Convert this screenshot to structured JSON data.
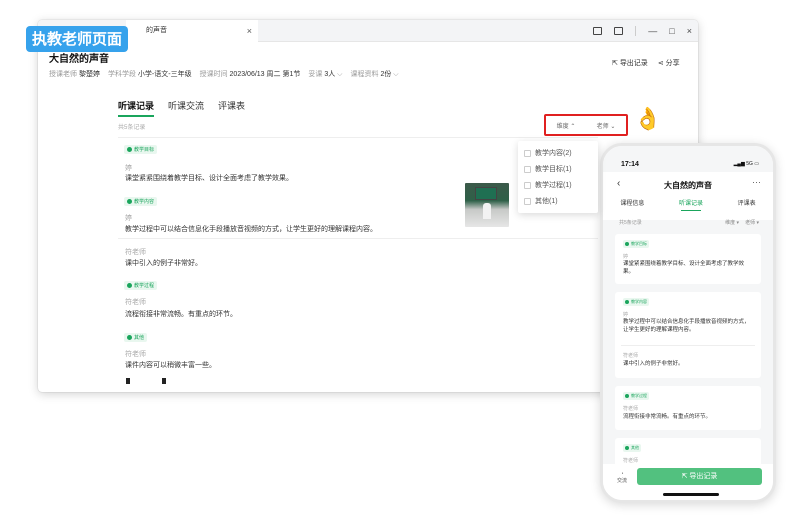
{
  "badge": "执教老师页面",
  "window": {
    "tab_title": "的声音",
    "tab_close": "×",
    "controls": [
      "—",
      "□",
      "×"
    ]
  },
  "header": {
    "course_title": "大自然的声音",
    "meta": [
      {
        "label": "授课老师",
        "value": "黎楚婷"
      },
      {
        "label": "学科学段",
        "value": "小学-语文-三年级"
      },
      {
        "label": "授课时间",
        "value": "2023/06/13 周二 第1节"
      },
      {
        "label": "妥课",
        "value": "3人"
      },
      {
        "label": "课程资料",
        "value": "2份"
      }
    ],
    "export_label": "导出记录",
    "share_label": "分享"
  },
  "tabs": [
    "听课记录",
    "听课交流",
    "评课表"
  ],
  "count_text": "共5条记录",
  "filters": {
    "dimension": "维度",
    "teacher": "老师"
  },
  "dropdown": [
    "教学内容(2)",
    "教学目标(1)",
    "教学过程(1)",
    "其他(1)"
  ],
  "records": [
    {
      "tag": "教学目标",
      "name": "婷",
      "text": "课堂紧紧围绕着教学目标、设计全面考虑了教学效果。"
    },
    {
      "tag": "教学内容",
      "name": "婷",
      "text": "教学过程中可以结合信息化手段播放音视频的方式，让学生更好的理解课程内容。"
    },
    {
      "tag": "",
      "name": "符老师",
      "text": "课中引入的例子非常好。"
    },
    {
      "tag": "教学过程",
      "name": "符老师",
      "text": "流程衔接非常流畅。有重点的环节。"
    },
    {
      "tag": "其他",
      "name": "符老师",
      "text": "课件内容可以稍微丰富一些。"
    }
  ],
  "phone": {
    "time": "17:14",
    "signal": "5G",
    "title": "大自然的声音",
    "tabs": [
      "课程信息",
      "听课记录",
      "评课表"
    ],
    "count_text": "共5条记录",
    "filters": [
      "维度",
      "老师"
    ],
    "cards": [
      {
        "tag": "教学目标",
        "name": "婷",
        "text": "课堂紧紧围绕着教学目标、设计全面考虑了教学效果。"
      },
      {
        "tag": "教学内容",
        "name": "婷",
        "text": "教学过程中可以结合信息化手段播放音视频的方式，让学生更好的理解课程内容。",
        "extra_name": "符老师",
        "extra_text": "课中引入的例子非常好。"
      },
      {
        "tag": "教学过程",
        "name": "符老师",
        "text": "流程衔接非常流畅。有重点的环节。"
      },
      {
        "tag": "其他",
        "name": "符老师",
        "text": ""
      }
    ],
    "chat_label": "交流",
    "export_label": "导出记录"
  }
}
